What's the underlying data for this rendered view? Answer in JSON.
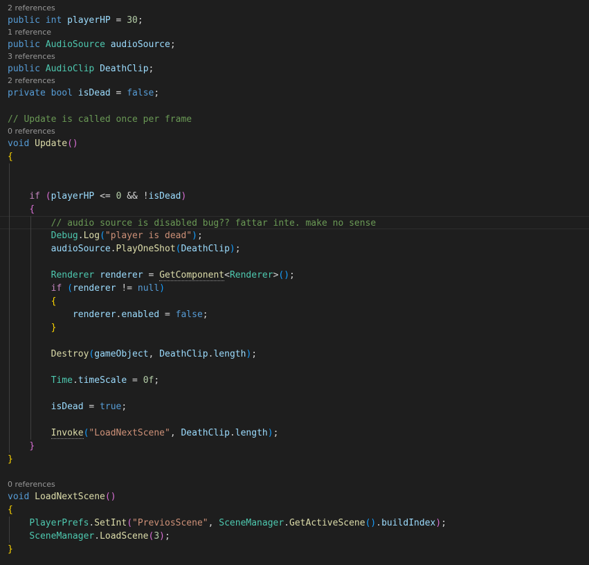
{
  "editor": {
    "tab_indent": "    ",
    "rows": [
      {
        "kind": "lens",
        "text": "2 references"
      },
      {
        "kind": "code",
        "indent": 0,
        "tokens": [
          [
            "kw",
            "public"
          ],
          [
            "p",
            " "
          ],
          [
            "kw",
            "int"
          ],
          [
            "p",
            " "
          ],
          [
            "var",
            "playerHP"
          ],
          [
            "p",
            " = "
          ],
          [
            "num",
            "30"
          ],
          [
            "p",
            ";"
          ]
        ]
      },
      {
        "kind": "lens",
        "text": "1 reference"
      },
      {
        "kind": "code",
        "indent": 0,
        "tokens": [
          [
            "kw",
            "public"
          ],
          [
            "p",
            " "
          ],
          [
            "ty",
            "AudioSource"
          ],
          [
            "p",
            " "
          ],
          [
            "var",
            "audioSource"
          ],
          [
            "p",
            ";"
          ]
        ]
      },
      {
        "kind": "lens",
        "text": "3 references"
      },
      {
        "kind": "code",
        "indent": 0,
        "tokens": [
          [
            "kw",
            "public"
          ],
          [
            "p",
            " "
          ],
          [
            "ty",
            "AudioClip"
          ],
          [
            "p",
            " "
          ],
          [
            "var",
            "DeathClip"
          ],
          [
            "p",
            ";"
          ]
        ]
      },
      {
        "kind": "lens",
        "text": "2 references"
      },
      {
        "kind": "code",
        "indent": 0,
        "tokens": [
          [
            "kw",
            "private"
          ],
          [
            "p",
            " "
          ],
          [
            "kw",
            "bool"
          ],
          [
            "p",
            " "
          ],
          [
            "var",
            "isDead"
          ],
          [
            "p",
            " = "
          ],
          [
            "kw",
            "false"
          ],
          [
            "p",
            ";"
          ]
        ]
      },
      {
        "kind": "blank"
      },
      {
        "kind": "code",
        "indent": 0,
        "tokens": [
          [
            "cm",
            "// Update is called once per frame"
          ]
        ]
      },
      {
        "kind": "lens",
        "text": "0 references"
      },
      {
        "kind": "code",
        "indent": 0,
        "tokens": [
          [
            "kw",
            "void"
          ],
          [
            "p",
            " "
          ],
          [
            "fn",
            "Update"
          ],
          [
            "b2",
            "()"
          ]
        ]
      },
      {
        "kind": "code",
        "indent": 0,
        "tokens": [
          [
            "b1",
            "{"
          ]
        ]
      },
      {
        "kind": "blank"
      },
      {
        "kind": "blank"
      },
      {
        "kind": "code",
        "indent": 1,
        "tokens": [
          [
            "ctl",
            "if"
          ],
          [
            "p",
            " "
          ],
          [
            "b2",
            "("
          ],
          [
            "var",
            "playerHP"
          ],
          [
            "p",
            " <= "
          ],
          [
            "num",
            "0"
          ],
          [
            "p",
            " && !"
          ],
          [
            "var",
            "isDead"
          ],
          [
            "b2",
            ")"
          ]
        ]
      },
      {
        "kind": "code",
        "indent": 1,
        "tokens": [
          [
            "b2",
            "{"
          ]
        ]
      },
      {
        "kind": "code",
        "indent": 2,
        "current": true,
        "tokens": [
          [
            "cm",
            "// audio source is disabled bug?? fattar inte. make no sense"
          ]
        ]
      },
      {
        "kind": "code",
        "indent": 2,
        "tokens": [
          [
            "ty",
            "Debug"
          ],
          [
            "p",
            "."
          ],
          [
            "fn",
            "Log"
          ],
          [
            "b3",
            "("
          ],
          [
            "str",
            "\"player is dead\""
          ],
          [
            "b3",
            ")"
          ],
          [
            "p",
            ";"
          ]
        ]
      },
      {
        "kind": "code",
        "indent": 2,
        "tokens": [
          [
            "var",
            "audioSource"
          ],
          [
            "p",
            "."
          ],
          [
            "fn",
            "PlayOneShot"
          ],
          [
            "b3",
            "("
          ],
          [
            "var",
            "DeathClip"
          ],
          [
            "b3",
            ")"
          ],
          [
            "p",
            ";"
          ]
        ]
      },
      {
        "kind": "blank"
      },
      {
        "kind": "code",
        "indent": 2,
        "tokens": [
          [
            "ty",
            "Renderer"
          ],
          [
            "p",
            " "
          ],
          [
            "var",
            "renderer"
          ],
          [
            "p",
            " = "
          ],
          [
            "fn",
            "GetComponent",
            "dot"
          ],
          [
            "p",
            "<"
          ],
          [
            "ty",
            "Renderer"
          ],
          [
            "p",
            ">"
          ],
          [
            "b3",
            "()"
          ],
          [
            "p",
            ";"
          ]
        ]
      },
      {
        "kind": "code",
        "indent": 2,
        "tokens": [
          [
            "ctl",
            "if"
          ],
          [
            "p",
            " "
          ],
          [
            "b3",
            "("
          ],
          [
            "var",
            "renderer"
          ],
          [
            "p",
            " != "
          ],
          [
            "kw",
            "null"
          ],
          [
            "b3",
            ")"
          ]
        ]
      },
      {
        "kind": "code",
        "indent": 2,
        "tokens": [
          [
            "b1",
            "{"
          ]
        ]
      },
      {
        "kind": "code",
        "indent": 3,
        "tokens": [
          [
            "var",
            "renderer"
          ],
          [
            "p",
            "."
          ],
          [
            "var",
            "enabled"
          ],
          [
            "p",
            " = "
          ],
          [
            "kw",
            "false"
          ],
          [
            "p",
            ";"
          ]
        ]
      },
      {
        "kind": "code",
        "indent": 2,
        "tokens": [
          [
            "b1",
            "}"
          ]
        ]
      },
      {
        "kind": "blank"
      },
      {
        "kind": "code",
        "indent": 2,
        "tokens": [
          [
            "fn",
            "Destroy"
          ],
          [
            "b3",
            "("
          ],
          [
            "var",
            "gameObject"
          ],
          [
            "p",
            ", "
          ],
          [
            "var",
            "DeathClip"
          ],
          [
            "p",
            "."
          ],
          [
            "var",
            "length"
          ],
          [
            "b3",
            ")"
          ],
          [
            "p",
            ";"
          ]
        ]
      },
      {
        "kind": "blank"
      },
      {
        "kind": "code",
        "indent": 2,
        "tokens": [
          [
            "ty",
            "Time"
          ],
          [
            "p",
            "."
          ],
          [
            "var",
            "timeScale"
          ],
          [
            "p",
            " = "
          ],
          [
            "num",
            "0f"
          ],
          [
            "p",
            ";"
          ]
        ]
      },
      {
        "kind": "blank"
      },
      {
        "kind": "code",
        "indent": 2,
        "tokens": [
          [
            "var",
            "isDead"
          ],
          [
            "p",
            " = "
          ],
          [
            "kw",
            "true"
          ],
          [
            "p",
            ";"
          ]
        ]
      },
      {
        "kind": "blank"
      },
      {
        "kind": "code",
        "indent": 2,
        "tokens": [
          [
            "fn",
            "Invoke",
            "dot"
          ],
          [
            "b3",
            "("
          ],
          [
            "str",
            "\"LoadNextScene\""
          ],
          [
            "p",
            ", "
          ],
          [
            "var",
            "DeathClip"
          ],
          [
            "p",
            "."
          ],
          [
            "var",
            "length"
          ],
          [
            "b3",
            ")"
          ],
          [
            "p",
            ";"
          ]
        ]
      },
      {
        "kind": "code",
        "indent": 1,
        "tokens": [
          [
            "b2",
            "}"
          ]
        ]
      },
      {
        "kind": "code",
        "indent": 0,
        "tokens": [
          [
            "b1",
            "}"
          ]
        ]
      },
      {
        "kind": "blank"
      },
      {
        "kind": "lens",
        "text": "0 references"
      },
      {
        "kind": "code",
        "indent": 0,
        "tokens": [
          [
            "kw",
            "void"
          ],
          [
            "p",
            " "
          ],
          [
            "fn",
            "LoadNextScene"
          ],
          [
            "b2",
            "()"
          ]
        ]
      },
      {
        "kind": "code",
        "indent": 0,
        "tokens": [
          [
            "b1",
            "{"
          ]
        ]
      },
      {
        "kind": "code",
        "indent": 1,
        "tokens": [
          [
            "ty",
            "PlayerPrefs"
          ],
          [
            "p",
            "."
          ],
          [
            "fn",
            "SetInt"
          ],
          [
            "b2",
            "("
          ],
          [
            "str",
            "\"PreviosScene\""
          ],
          [
            "p",
            ", "
          ],
          [
            "ty",
            "SceneManager"
          ],
          [
            "p",
            "."
          ],
          [
            "fn",
            "GetActiveScene"
          ],
          [
            "b3",
            "()"
          ],
          [
            "p",
            "."
          ],
          [
            "var",
            "buildIndex"
          ],
          [
            "b2",
            ")"
          ],
          [
            "p",
            ";"
          ]
        ]
      },
      {
        "kind": "code",
        "indent": 1,
        "tokens": [
          [
            "ty",
            "SceneManager"
          ],
          [
            "p",
            "."
          ],
          [
            "fn",
            "LoadScene"
          ],
          [
            "b2",
            "("
          ],
          [
            "num",
            "3"
          ],
          [
            "b2",
            ")"
          ],
          [
            "p",
            ";"
          ]
        ]
      },
      {
        "kind": "code",
        "indent": 0,
        "tokens": [
          [
            "b1",
            "}"
          ]
        ]
      }
    ]
  }
}
